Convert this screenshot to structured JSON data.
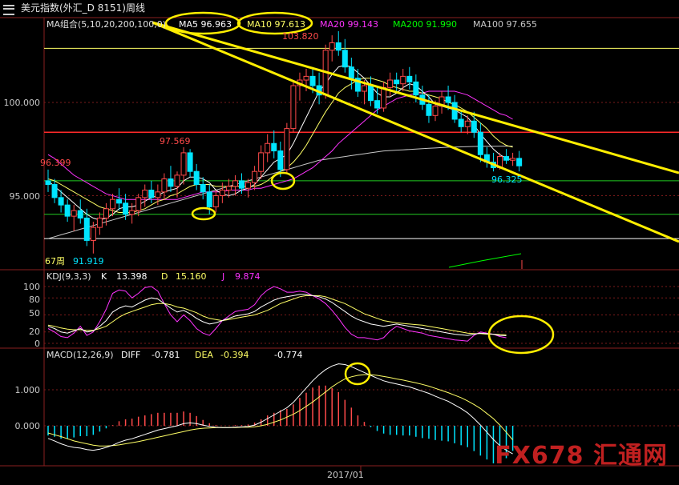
{
  "header": {
    "title": "美元指数(外汇_D 8151)周线",
    "ma_group": "MA组合(5,10,20,200,100,0)",
    "ma5": "MA5 96.963",
    "ma10": "MA10 97.613",
    "ma20": "MA20 99.143",
    "ma200": "MA200 91.990",
    "ma100": "MA100 97.655"
  },
  "colors": {
    "up": "#ff4a4a",
    "down": "#00e5ff",
    "ma5": "#ffffff",
    "ma10": "#ffff66",
    "ma20": "#ff33ff",
    "ma100": "#c8c8c8",
    "ma200": "#00ff00",
    "channel": "#ffee00",
    "highlight": "#ffee00"
  },
  "chart_data": [
    {
      "type": "candlestick",
      "yaxis_ticks": [
        "100.000",
        "95.000"
      ],
      "annotations": {
        "high": "103.820",
        "mid_high": "97.569",
        "left_high": "96.399",
        "last_low": "96.325",
        "low": "91.919",
        "period": "67周"
      },
      "x_tick": "2017/01",
      "horizontal_lines": [
        {
          "value": 102.9,
          "color": "#ffff66"
        },
        {
          "value": 98.4,
          "color": "#ff2a2a"
        },
        {
          "value": 95.8,
          "color": "#22cc22"
        },
        {
          "value": 94.0,
          "color": "#22cc22"
        },
        {
          "value": 92.7,
          "color": "#ffffff"
        }
      ],
      "ohlc": [
        [
          95.8,
          96.4,
          95.2,
          95.6
        ],
        [
          95.6,
          95.9,
          94.6,
          94.9
        ],
        [
          94.9,
          95.3,
          94.1,
          94.5
        ],
        [
          94.5,
          94.8,
          93.6,
          93.9
        ],
        [
          93.9,
          94.5,
          93.1,
          94.2
        ],
        [
          94.2,
          94.8,
          93.5,
          93.8
        ],
        [
          93.8,
          94.3,
          92.3,
          92.6
        ],
        [
          92.6,
          93.6,
          91.9,
          93.3
        ],
        [
          93.3,
          94.1,
          92.9,
          93.8
        ],
        [
          93.8,
          94.6,
          93.4,
          94.3
        ],
        [
          94.3,
          95.1,
          93.9,
          94.8
        ],
        [
          94.8,
          95.4,
          94.2,
          94.6
        ],
        [
          94.6,
          95.1,
          93.7,
          94.0
        ],
        [
          94.0,
          94.6,
          93.5,
          94.2
        ],
        [
          94.2,
          95.1,
          93.9,
          94.9
        ],
        [
          94.9,
          95.6,
          94.4,
          95.3
        ],
        [
          95.3,
          95.8,
          94.6,
          94.9
        ],
        [
          94.9,
          95.6,
          94.5,
          95.2
        ],
        [
          95.2,
          96.2,
          94.8,
          95.9
        ],
        [
          95.9,
          96.6,
          95.2,
          95.5
        ],
        [
          95.5,
          96.3,
          94.9,
          96.1
        ],
        [
          96.1,
          97.6,
          95.6,
          97.3
        ],
        [
          97.3,
          97.5,
          96.0,
          96.3
        ],
        [
          96.3,
          96.7,
          95.3,
          95.6
        ],
        [
          95.6,
          96.0,
          94.8,
          95.2
        ],
        [
          95.2,
          95.6,
          94.0,
          94.4
        ],
        [
          94.4,
          95.3,
          94.1,
          95.0
        ],
        [
          95.0,
          95.7,
          94.6,
          95.3
        ],
        [
          95.3,
          95.9,
          94.9,
          95.5
        ],
        [
          95.5,
          96.1,
          95.0,
          95.8
        ],
        [
          95.8,
          96.2,
          95.1,
          95.4
        ],
        [
          95.4,
          95.9,
          94.9,
          95.7
        ],
        [
          95.7,
          96.6,
          95.3,
          96.3
        ],
        [
          96.3,
          97.7,
          95.9,
          97.3
        ],
        [
          97.3,
          98.3,
          96.8,
          97.8
        ],
        [
          97.8,
          98.5,
          97.0,
          97.4
        ],
        [
          97.4,
          97.9,
          96.0,
          96.4
        ],
        [
          96.4,
          98.9,
          96.2,
          98.6
        ],
        [
          98.6,
          101.2,
          98.4,
          100.9
        ],
        [
          100.9,
          101.6,
          100.1,
          101.2
        ],
        [
          101.2,
          101.8,
          100.6,
          101.4
        ],
        [
          101.4,
          101.9,
          100.5,
          100.9
        ],
        [
          100.9,
          101.6,
          99.9,
          100.4
        ],
        [
          100.4,
          103.1,
          100.2,
          102.8
        ],
        [
          102.8,
          103.6,
          102.2,
          103.2
        ],
        [
          103.2,
          103.82,
          102.5,
          102.8
        ],
        [
          102.8,
          103.4,
          101.6,
          101.9
        ],
        [
          101.9,
          102.4,
          100.7,
          101.3
        ],
        [
          101.3,
          101.8,
          100.3,
          100.6
        ],
        [
          100.6,
          101.2,
          99.9,
          100.9
        ],
        [
          100.9,
          101.4,
          99.8,
          100.1
        ],
        [
          100.1,
          100.8,
          99.4,
          99.7
        ],
        [
          99.7,
          101.1,
          99.5,
          100.8
        ],
        [
          100.8,
          101.6,
          100.3,
          101.2
        ],
        [
          101.2,
          101.6,
          100.5,
          101.0
        ],
        [
          101.0,
          101.8,
          100.6,
          101.4
        ],
        [
          101.4,
          101.9,
          100.7,
          101.1
        ],
        [
          101.1,
          101.5,
          100.0,
          100.4
        ],
        [
          100.4,
          100.9,
          99.6,
          99.9
        ],
        [
          99.9,
          100.4,
          98.9,
          99.3
        ],
        [
          99.3,
          100.1,
          99.0,
          99.8
        ],
        [
          99.8,
          100.6,
          99.4,
          100.3
        ],
        [
          100.3,
          100.9,
          99.6,
          100.0
        ],
        [
          100.0,
          100.4,
          98.9,
          99.1
        ],
        [
          99.1,
          99.6,
          98.4,
          98.7
        ],
        [
          98.7,
          99.3,
          98.3,
          99.0
        ],
        [
          99.0,
          99.5,
          98.1,
          98.4
        ],
        [
          98.4,
          98.9,
          96.8,
          97.2
        ],
        [
          97.2,
          97.6,
          96.5,
          96.8
        ],
        [
          96.8,
          97.3,
          96.3,
          96.5
        ],
        [
          96.5,
          97.3,
          96.4,
          97.1
        ],
        [
          97.1,
          97.5,
          96.7,
          96.9
        ],
        [
          96.9,
          97.3,
          96.6,
          97.0
        ],
        [
          97.0,
          97.4,
          96.3,
          96.6
        ]
      ],
      "ma5": [
        95.8,
        95.5,
        95.2,
        94.9,
        94.6,
        94.3,
        94.0,
        93.8,
        93.7,
        93.8,
        94.0,
        94.3,
        94.4,
        94.4,
        94.5,
        94.7,
        94.9,
        95.0,
        95.2,
        95.3,
        95.4,
        95.8,
        96.0,
        96.0,
        95.9,
        95.7,
        95.3,
        95.1,
        95.0,
        95.1,
        95.3,
        95.4,
        95.6,
        96.0,
        96.4,
        96.8,
        97.0,
        97.2,
        97.8,
        98.5,
        99.2,
        99.9,
        100.6,
        101.0,
        101.5,
        101.9,
        102.0,
        101.9,
        101.6,
        101.3,
        100.9,
        100.5,
        100.3,
        100.3,
        100.5,
        100.8,
        101.0,
        100.9,
        100.6,
        100.3,
        99.9,
        99.8,
        99.7,
        99.6,
        99.4,
        99.2,
        98.8,
        98.3,
        97.9,
        97.5,
        97.2,
        97.0,
        96.9
      ],
      "ma10": [
        95.9,
        95.8,
        95.6,
        95.4,
        95.2,
        95.0,
        94.8,
        94.6,
        94.4,
        94.3,
        94.2,
        94.1,
        94.1,
        94.1,
        94.2,
        94.3,
        94.5,
        94.7,
        94.8,
        95.0,
        95.1,
        95.3,
        95.5,
        95.6,
        95.6,
        95.6,
        95.5,
        95.5,
        95.5,
        95.5,
        95.5,
        95.5,
        95.5,
        95.6,
        95.8,
        96.1,
        96.3,
        96.5,
        96.8,
        97.2,
        97.7,
        98.3,
        98.9,
        99.5,
        100.0,
        100.5,
        100.8,
        101.0,
        101.2,
        101.3,
        101.3,
        101.2,
        101.1,
        100.9,
        100.8,
        100.7,
        100.6,
        100.6,
        100.5,
        100.4,
        100.3,
        100.2,
        100.0,
        99.9,
        99.7,
        99.5,
        99.2,
        98.9,
        98.6,
        98.2,
        97.9,
        97.7,
        97.6
      ],
      "ma20": [
        97.2,
        97.0,
        96.7,
        96.4,
        96.1,
        95.9,
        95.7,
        95.5,
        95.3,
        95.1,
        95.0,
        94.9,
        94.8,
        94.8,
        94.8,
        94.8,
        94.8,
        94.8,
        94.8,
        94.8,
        94.8,
        94.9,
        95.0,
        95.1,
        95.2,
        95.2,
        95.2,
        95.2,
        95.3,
        95.3,
        95.3,
        95.3,
        95.4,
        95.4,
        95.5,
        95.6,
        95.7,
        95.8,
        95.9,
        96.1,
        96.3,
        96.5,
        96.8,
        97.1,
        97.4,
        97.8,
        98.1,
        98.4,
        98.7,
        99.0,
        99.3,
        99.6,
        99.8,
        100.0,
        100.2,
        100.3,
        100.4,
        100.5,
        100.5,
        100.6,
        100.6,
        100.6,
        100.6,
        100.6,
        100.5,
        100.4,
        100.2,
        100.0,
        99.8,
        99.6,
        99.4,
        99.3,
        99.1
      ],
      "ma100": [
        92.7,
        92.8,
        92.9,
        93.0,
        93.1,
        93.2,
        93.3,
        93.4,
        93.5,
        93.6,
        93.7,
        93.8,
        93.9,
        94.0,
        94.1,
        94.2,
        94.3,
        94.4,
        94.5,
        94.6,
        94.7,
        94.8,
        94.9,
        95.0,
        95.1,
        95.2,
        95.3,
        95.4,
        95.5,
        95.6,
        95.7,
        95.8,
        95.9,
        96.0,
        96.1,
        96.2,
        96.3,
        96.4,
        96.5,
        96.6,
        96.7,
        96.8,
        96.9,
        96.95,
        97.0,
        97.05,
        97.1,
        97.15,
        97.2,
        97.25,
        97.3,
        97.35,
        97.4,
        97.42,
        97.44,
        97.46,
        97.48,
        97.5,
        97.52,
        97.54,
        97.56,
        97.58,
        97.6,
        97.61,
        97.62,
        97.63,
        97.64,
        97.65,
        97.65,
        97.65,
        97.655,
        97.655,
        97.655
      ],
      "channel_upper": [
        [
          190,
          28
        ],
        [
          847,
          216
        ]
      ],
      "channel_lower": [
        [
          190,
          28
        ],
        [
          847,
          302
        ]
      ]
    },
    {
      "type": "line",
      "label": "KDJ(9,3,3)",
      "k_label": "K",
      "k_value": "13.398",
      "d_label": "D",
      "d_value": "15.160",
      "j_label": "J",
      "j_value": "9.874",
      "yaxis_ticks": [
        "100",
        "80",
        "50",
        "20",
        "0"
      ],
      "ylim": [
        0,
        110
      ],
      "k": [
        30,
        26,
        20,
        18,
        22,
        26,
        20,
        22,
        30,
        40,
        55,
        62,
        66,
        64,
        70,
        76,
        80,
        78,
        70,
        62,
        55,
        58,
        52,
        44,
        38,
        34,
        36,
        40,
        44,
        48,
        50,
        52,
        56,
        64,
        70,
        76,
        80,
        82,
        84,
        86,
        86,
        84,
        82,
        78,
        72,
        64,
        56,
        48,
        42,
        38,
        34,
        32,
        30,
        32,
        34,
        32,
        30,
        28,
        26,
        24,
        22,
        20,
        18,
        16,
        15,
        14,
        16,
        18,
        17,
        16,
        14,
        13.4
      ],
      "d": [
        32,
        30,
        27,
        25,
        24,
        24,
        23,
        23,
        26,
        30,
        38,
        46,
        52,
        56,
        60,
        64,
        68,
        70,
        70,
        68,
        64,
        62,
        58,
        54,
        48,
        44,
        42,
        40,
        42,
        44,
        46,
        48,
        50,
        54,
        58,
        64,
        70,
        74,
        78,
        82,
        84,
        84,
        84,
        82,
        78,
        74,
        70,
        64,
        58,
        52,
        48,
        44,
        40,
        38,
        36,
        35,
        34,
        33,
        32,
        30,
        28,
        26,
        24,
        22,
        20,
        18,
        17,
        17,
        16,
        16,
        15.5,
        15.2
      ],
      "j": [
        26,
        20,
        12,
        10,
        18,
        30,
        14,
        20,
        38,
        60,
        88,
        94,
        92,
        80,
        88,
        98,
        100,
        92,
        70,
        50,
        38,
        50,
        40,
        26,
        18,
        14,
        26,
        40,
        48,
        56,
        58,
        60,
        68,
        84,
        94,
        100,
        96,
        90,
        90,
        92,
        90,
        84,
        78,
        70,
        58,
        44,
        28,
        16,
        10,
        10,
        8,
        6,
        10,
        22,
        30,
        26,
        22,
        20,
        18,
        14,
        12,
        10,
        8,
        6,
        5,
        4,
        14,
        20,
        18,
        16,
        12,
        9.9
      ]
    },
    {
      "type": "line",
      "label": "MACD(12,26,9)",
      "diff_label": "DIFF",
      "diff_value": "-0.781",
      "dea_label": "DEA",
      "dea_value": "-0.394",
      "macd_value": "-0.774",
      "yaxis_ticks": [
        "1.000",
        "0.000"
      ],
      "ylim": [
        -1.0,
        1.8
      ],
      "diff": [
        -0.35,
        -0.42,
        -0.5,
        -0.56,
        -0.6,
        -0.62,
        -0.66,
        -0.68,
        -0.65,
        -0.6,
        -0.54,
        -0.46,
        -0.4,
        -0.36,
        -0.3,
        -0.24,
        -0.18,
        -0.12,
        -0.08,
        -0.04,
        0.0,
        0.06,
        0.08,
        0.06,
        0.02,
        -0.02,
        -0.04,
        -0.05,
        -0.05,
        -0.04,
        -0.03,
        -0.02,
        0.02,
        0.1,
        0.2,
        0.3,
        0.4,
        0.5,
        0.65,
        0.85,
        1.05,
        1.25,
        1.42,
        1.56,
        1.66,
        1.72,
        1.7,
        1.64,
        1.56,
        1.48,
        1.4,
        1.32,
        1.25,
        1.2,
        1.16,
        1.12,
        1.08,
        1.02,
        0.96,
        0.9,
        0.82,
        0.75,
        0.68,
        0.58,
        0.48,
        0.36,
        0.2,
        0.02,
        -0.18,
        -0.38,
        -0.55,
        -0.68,
        -0.781
      ],
      "dea": [
        -0.2,
        -0.25,
        -0.3,
        -0.36,
        -0.42,
        -0.46,
        -0.5,
        -0.54,
        -0.56,
        -0.56,
        -0.55,
        -0.53,
        -0.5,
        -0.47,
        -0.44,
        -0.4,
        -0.36,
        -0.32,
        -0.28,
        -0.24,
        -0.2,
        -0.16,
        -0.12,
        -0.09,
        -0.07,
        -0.06,
        -0.05,
        -0.05,
        -0.05,
        -0.05,
        -0.04,
        -0.04,
        -0.03,
        0.0,
        0.04,
        0.1,
        0.16,
        0.24,
        0.32,
        0.42,
        0.54,
        0.66,
        0.8,
        0.94,
        1.08,
        1.2,
        1.3,
        1.36,
        1.4,
        1.42,
        1.42,
        1.4,
        1.37,
        1.34,
        1.3,
        1.27,
        1.23,
        1.19,
        1.15,
        1.1,
        1.04,
        0.98,
        0.92,
        0.85,
        0.78,
        0.69,
        0.59,
        0.48,
        0.34,
        0.2,
        0.02,
        -0.18,
        -0.394
      ]
    }
  ]
}
